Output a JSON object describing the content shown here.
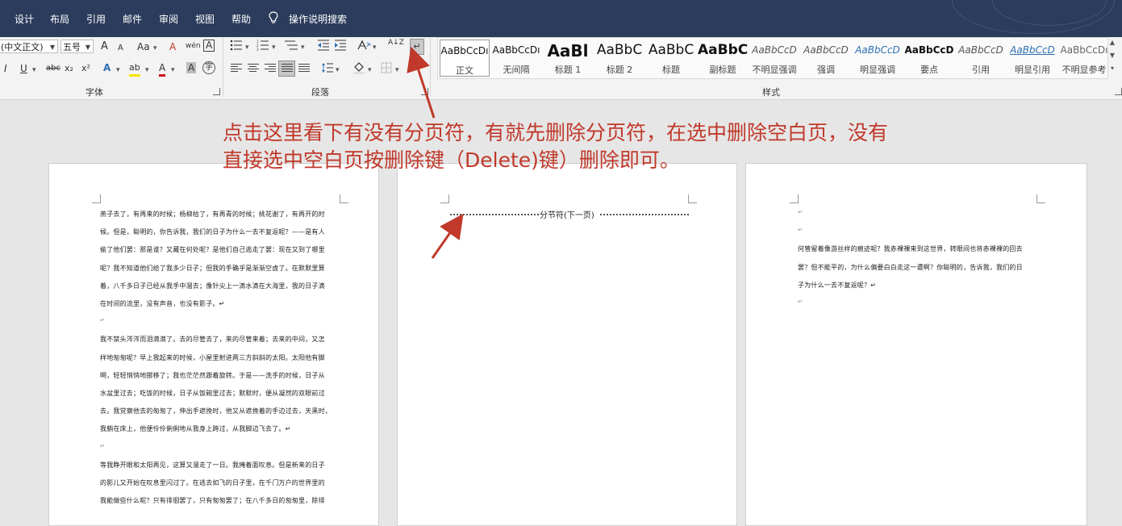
{
  "menu": {
    "items": [
      "设计",
      "布局",
      "引用",
      "邮件",
      "审阅",
      "视图",
      "帮助"
    ],
    "tell_me": "操作说明搜索"
  },
  "ribbon": {
    "font": {
      "font_name": "(中文正文)",
      "font_size": "五号",
      "grow": "A",
      "shrink": "A",
      "case": "Aa",
      "clear": "A",
      "phonetic": "wén",
      "border_char": "A",
      "italic": "I",
      "underline": "U",
      "strike": "abc",
      "subscript": "x₂",
      "superscript": "x²",
      "text_effects": "A",
      "highlight": "ab",
      "font_color": "A",
      "shading": "A",
      "enclose": "字",
      "label": "字体"
    },
    "paragraph": {
      "label": "段落",
      "sort": "A↓Z",
      "show_marks": "↵"
    },
    "styles": {
      "label": "样式",
      "items": [
        {
          "sample": "AaBbCcDı",
          "name": "正文",
          "selected": true
        },
        {
          "sample": "AaBbCcDı",
          "name": "无间隔"
        },
        {
          "sample": "AaBl",
          "name": "标题 1"
        },
        {
          "sample": "AaBbC",
          "name": "标题 2"
        },
        {
          "sample": "AaBbC",
          "name": "标题"
        },
        {
          "sample": "AaBbC",
          "name": "副标题"
        },
        {
          "sample": "AaBbCcD",
          "name": "不明显强调"
        },
        {
          "sample": "AaBbCcD",
          "name": "强调"
        },
        {
          "sample": "AaBbCcD",
          "name": "明显强调"
        },
        {
          "sample": "AaBbCcD",
          "name": "要点"
        },
        {
          "sample": "AaBbCcD",
          "name": "引用"
        },
        {
          "sample": "AaBbCcD",
          "name": "明显引用"
        },
        {
          "sample": "AaBbCcDı",
          "name": "不明显参考"
        }
      ]
    }
  },
  "annotation": {
    "text": "点击这里看下有没有分页符，有就先删除分页符，在选中删除空白页，没有直接选中空白页按删除键（Delete)键）删除即可。",
    "color": "#c0392b"
  },
  "pages": {
    "page1": {
      "lines": [
        "燕子去了，有再来的时候；杨柳枯了，有再青的时候；桃花谢了，有再开的时",
        "候。但是，聪明的，你告诉我，我们的日子为什么一去不复返呢？——是有人",
        "偷了他们罢：那是谁？又藏在何处呢？是他们自己逃走了罢：现在又到了哪里",
        "呢？我不知道他们给了我多少日子；但我的手确乎是渐渐空虚了。在默默里算",
        "着，八千多日子已经从我手中溜去；像针尖上一滴水滴在大海里，我的日子滴",
        "在时间的流里，没有声音，也没有影子。↵",
        "↵",
        "我不禁头涔涔而泪潸潸了。去的尽管去了，来的尽管来着；去来的中间，又怎",
        "样地匆匆呢？早上我起来的时候，小屋里射进两三方斜斜的太阳。太阳他有脚",
        "啊，轻轻悄悄地挪移了；我也茫茫然跟着旋转。于是——洗手的时候，日子从",
        "水盆里过去；吃饭的时候，日子从饭碗里过去；默默时，便从凝然的双眼前过",
        "去。我觉察他去的匆匆了，伸出手遮挽时，他又从遮挽着的手边过去，天黑时，",
        "我躺在床上，他便伶伶俐俐地从我身上跨过，从我脚边飞去了。↵",
        "↵",
        "等我睁开眼和太阳再见，这算又溜走了一日。我掩着面叹息。但是新来的日子",
        "的影儿又开始在叹息里闪过了。在逃去如飞的日子里，在千门万户的世界里的",
        "我能做些什么呢？只有徘徊罢了，只有匆匆罢了；在八千多日的匆匆里，除徘"
      ]
    },
    "page2": {
      "section_break": "分节符(下一页)"
    },
    "page3": {
      "lines": [
        "↵",
        "↵",
        "何曾留着像游丝样的痕迹呢？我赤裸裸来到这世界，转眼间也将赤裸裸的回去",
        "罢？但不能平的，为什么偏要白白走这一遭啊？你聪明的，告诉我，我们的日",
        "子为什么一去不复返呢？↵",
        "↵"
      ]
    }
  }
}
